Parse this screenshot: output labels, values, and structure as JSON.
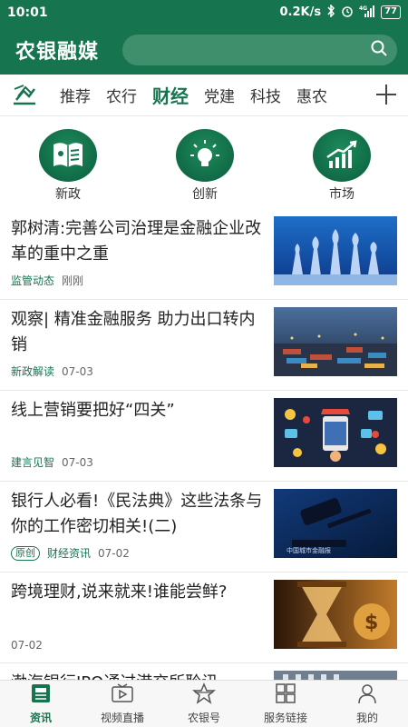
{
  "status": {
    "time": "10:01",
    "net_speed": "0.2K/s",
    "network": "4G",
    "battery": "77"
  },
  "header": {
    "title": "农银融媒",
    "search_icon": "search-icon"
  },
  "tabs": [
    {
      "label": "推荐"
    },
    {
      "label": "农行"
    },
    {
      "label": "财经",
      "active": true
    },
    {
      "label": "党建"
    },
    {
      "label": "科技"
    },
    {
      "label": "惠农"
    }
  ],
  "categories": [
    {
      "label": "新政",
      "icon": "book-icon"
    },
    {
      "label": "创新",
      "icon": "lightbulb-icon"
    },
    {
      "label": "市场",
      "icon": "growth-chart-icon"
    }
  ],
  "news": [
    {
      "title": "郭树清:完善公司治理是金融企业改革的重中之重",
      "tag": "监管动态",
      "date": "刚刚",
      "badge": "",
      "thumb": "chess-image"
    },
    {
      "title": "观察| 精准金融服务  助力出口转内销",
      "tag": "新政解读",
      "date": "07-03",
      "badge": "",
      "thumb": "port-image"
    },
    {
      "title": "线上营销要把好“四关”",
      "tag": "建言见智",
      "date": "07-03",
      "badge": "",
      "thumb": "online-marketing-image"
    },
    {
      "title": "银行人必看!《民法典》这些法条与你的工作密切相关!(二)",
      "tag": "财经资讯",
      "date": "07-02",
      "badge": "原创",
      "thumb": "gavel-image",
      "thumb_caption": "中国城市金融报"
    },
    {
      "title": "跨境理财,说来就来!谁能尝鲜?",
      "tag": "",
      "date": "07-02",
      "badge": "",
      "thumb": "hourglass-image"
    },
    {
      "title": "渤海银行IPO通过港交所聆讯",
      "tag": "",
      "date": "",
      "badge": "",
      "thumb": "building-image"
    }
  ],
  "bottom_nav": [
    {
      "label": "资讯",
      "icon": "news-icon",
      "active": true
    },
    {
      "label": "视频直播",
      "icon": "video-icon"
    },
    {
      "label": "农银号",
      "icon": "star-icon"
    },
    {
      "label": "服务链接",
      "icon": "grid-icon"
    },
    {
      "label": "我的",
      "icon": "user-icon"
    }
  ],
  "colors": {
    "brand": "#16754f",
    "brand_light": "#3f8f6d"
  }
}
